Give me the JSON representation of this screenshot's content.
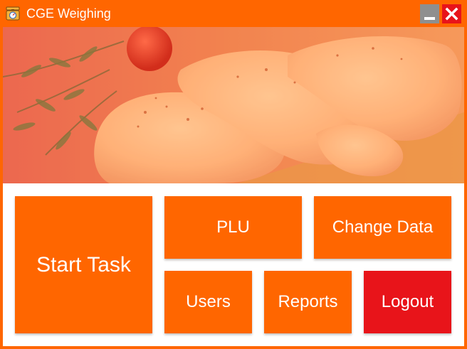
{
  "window": {
    "title": "CGE Weighing",
    "app_icon": "scale-icon",
    "minimize_icon": "minimize-icon",
    "close_icon": "close-icon"
  },
  "menu": {
    "start_task": "Start Task",
    "plu": "PLU",
    "change_data": "Change Data",
    "users": "Users",
    "reports": "Reports",
    "logout": "Logout"
  },
  "colors": {
    "accent": "#ff6600",
    "danger": "#e8141a",
    "minimize": "#8f8f8f"
  }
}
